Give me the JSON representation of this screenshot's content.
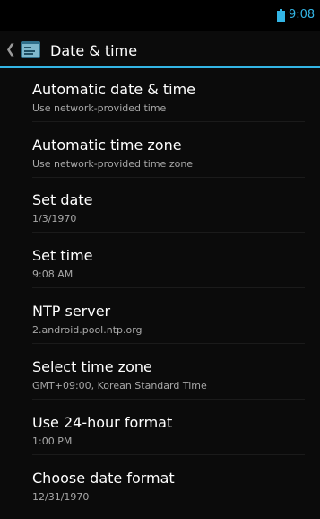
{
  "status_bar": {
    "time": "9:08",
    "accent_color": "#33b5e5"
  },
  "action_bar": {
    "title": "Date & time",
    "back_icon": "chevron-left",
    "app_icon": "settings-icon"
  },
  "settings": [
    {
      "title": "Automatic date & time",
      "summary": "Use network-provided time"
    },
    {
      "title": "Automatic time zone",
      "summary": "Use network-provided time zone"
    },
    {
      "title": "Set date",
      "summary": "1/3/1970"
    },
    {
      "title": "Set time",
      "summary": "9:08 AM"
    },
    {
      "title": "NTP server",
      "summary": "2.android.pool.ntp.org"
    },
    {
      "title": "Select time zone",
      "summary": "GMT+09:00, Korean Standard Time"
    },
    {
      "title": "Use 24-hour format",
      "summary": "1:00 PM"
    },
    {
      "title": "Choose date format",
      "summary": "12/31/1970"
    }
  ]
}
